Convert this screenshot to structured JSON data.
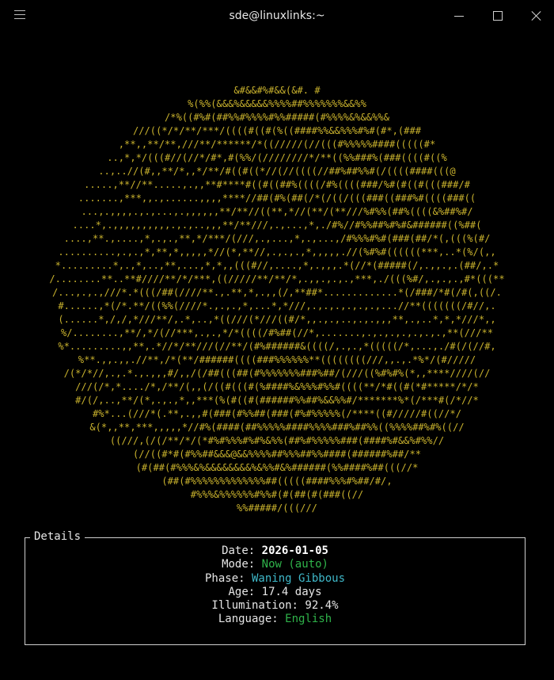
{
  "window": {
    "title": "sde@linuxlinks:~"
  },
  "moon_art": [
    {
      "x": 0,
      "text": "&#&&#%#&&(&#. #"
    },
    {
      "x": 0,
      "text": "%(%%(&&&%&&&&&%%%%##%%%%%%%&&%%"
    },
    {
      "x": 0,
      "text": "/*%((#%#(##%%#%%%%#%%#####(#%%%%&%&&%%&"
    },
    {
      "x": 0,
      "text": "///((*/*/**/***/((((#((#(%((####%%&&%%%#%#(#*,(###"
    },
    {
      "x": 0,
      "text": ",**,,**/**,///**/******/*((/////(//(((#%%%%%####(((((#*"
    },
    {
      "x": 0,
      "text": "..,*,*/(((#//(//*/#*,#(%%/(////////*/**((%%###%(###((((#((%"
    },
    {
      "x": 0,
      "text": "..,..//(#,,**/*,,*/**/#((#((*//(//((((//##%##%%#(/((((####(((@"
    },
    {
      "x": 0,
      "text": ".....,**//**.....,.,,**#****#((#((##%((((/#%((((###/%#(#((#(((###/#"
    },
    {
      "x": 0,
      "text": ".......,***,,.,......,,,,****//##(#%(##(/*(/((/(((###((###%#((((###(("
    },
    {
      "x": 0,
      "text": "...,.,,,,.,.,...,.,,,,,,**/**//((**,*//(**/(**///%#%%(##%((((&%##%#/"
    },
    {
      "x": 0,
      "text": "....*,.,,,,,,,,,,.,.,..,,,**/**///,.,...,*,./#%//#%%##%#%#&######((%##("
    },
    {
      "x": 0,
      "text": "....,**.,....,*,.,.,**,*/***/(///,.,...,*,.,...,/#%%%#%#(###(##/*(,(((%(#/"
    },
    {
      "x": 0,
      "text": "..........,.,.,*,**,*,,,,,*//(*,**//,.,.,.,*,,,,,.//(%#%#((((((***,..*(%/(,,"
    },
    {
      "x": 0,
      "text": "*.........*,.,*,..,**,...,*,*,,(((#//,....,*,.,,,.*(//*(#####(/,.,,.,.(##/,.*"
    },
    {
      "x": 0,
      "text": "/........**..**#////**/*/***,((/////**/**/*,.,,.,.,.,***,./(((%#/,.,.,.,#*(((**"
    },
    {
      "x": 0,
      "text": "/...,.,.,///*.*(((/##(////**.,.**,*,.,,(/,**##*.............*(/###/*#(/#(,((/."
    },
    {
      "x": 0,
      "text": "#......,*(/*.**/((%%(////*.,.,.,*,...*,*///,.,.,.,.,.,.,...//**(((((((/#//,."
    },
    {
      "x": 0,
      "text": "(......*,/,/,*///**/,.*,..,*((///(*///((#/*,,.,.,..,.,.,,,**,.,..*,*,*///*,,"
    },
    {
      "x": 0,
      "text": "%/........,**/,*/(//***,.,.,*/*((((/#%##(//*,.......,.,.,.,.,.,.,.,**(///**"
    },
    {
      "x": 0,
      "text": "%*.........,,**,.*//*/**///(//**/(#%######&((((/,.,.,*(((((/*,...,./#(/(//#,"
    },
    {
      "x": 0,
      "text": "%**.,,.,,.//**,/*(**/######((((###%%%%%%**((((((((///,,.,.*%*/(#/////"
    },
    {
      "x": 0,
      "text": "/(*/*//,.,.*.,.,,,#/,,/(/##(((##(#%%%%%%%###%##/(///((%#%#%(*,,****////(//"
    },
    {
      "x": 0,
      "text": "///(/*,*..../*,/**/(,,(/((#(((#(%####%&%%%#%%#((((**/*#((#(*#*****/*/*"
    },
    {
      "x": 0,
      "text": "#/(/,..,**/(*,.,.,*,,***(%(#((#(######%%##%&&%%#/*******%*(/***#(/*//*"
    },
    {
      "x": 0,
      "text": "#%*...(///*(.**,.,,#(###(#%%##(###(#%#%%%%%(/****((#/////#((//*/"
    },
    {
      "x": 0,
      "text": "&(*,,**,***,,,,,*//#%(####(##%%%%%####%%%%###%##%%((%%%%##%#%((//"
    },
    {
      "x": 0,
      "text": "((///,(/(/**/*/(*#%#%%%#%#%&%%(##%#%%%%%###(####%#&&%#%%//"
    },
    {
      "x": 0,
      "text": "(//((#*#(#%%##&&&@&&%%%%##%%%##%%####(######%##/**"
    },
    {
      "x": 0,
      "text": "(#(##(#%%%&%&&&&&&&&%&%%#&%######(%%####%##(((//*"
    },
    {
      "x": 0,
      "text": "(##(#%%%%%%%%%%%%%##(((((####%%%#%##/#/,"
    },
    {
      "x": 0,
      "text": "#%%%&%%%%%%#%%#(#(##(#(###((//"
    },
    {
      "x": 0,
      "text": "%%#####/(((///"
    }
  ],
  "details": {
    "title": "Details",
    "rows": [
      {
        "label": "Date:",
        "value": "2026-01-05",
        "style": "val-bold"
      },
      {
        "label": "Mode:",
        "value": "Now (auto)",
        "style": "val-green"
      },
      {
        "label": "Phase:",
        "value": "Waning Gibbous",
        "style": "val-cyan"
      },
      {
        "label": "Age:",
        "value": "17.4 days",
        "style": "val-plain"
      },
      {
        "label": "Illumination:",
        "value": "92.4%",
        "style": "val-plain"
      },
      {
        "label": "Language:",
        "value": "English",
        "style": "val-green"
      }
    ]
  },
  "colors": {
    "background": "#000000",
    "moon_ascii": "#c9b22d",
    "moon_shadow": "#6e6e6e",
    "bold_value": "#ffffff",
    "green_value": "#2fb34a",
    "cyan_value": "#3fb8c9",
    "border": "#cfcfcf"
  }
}
